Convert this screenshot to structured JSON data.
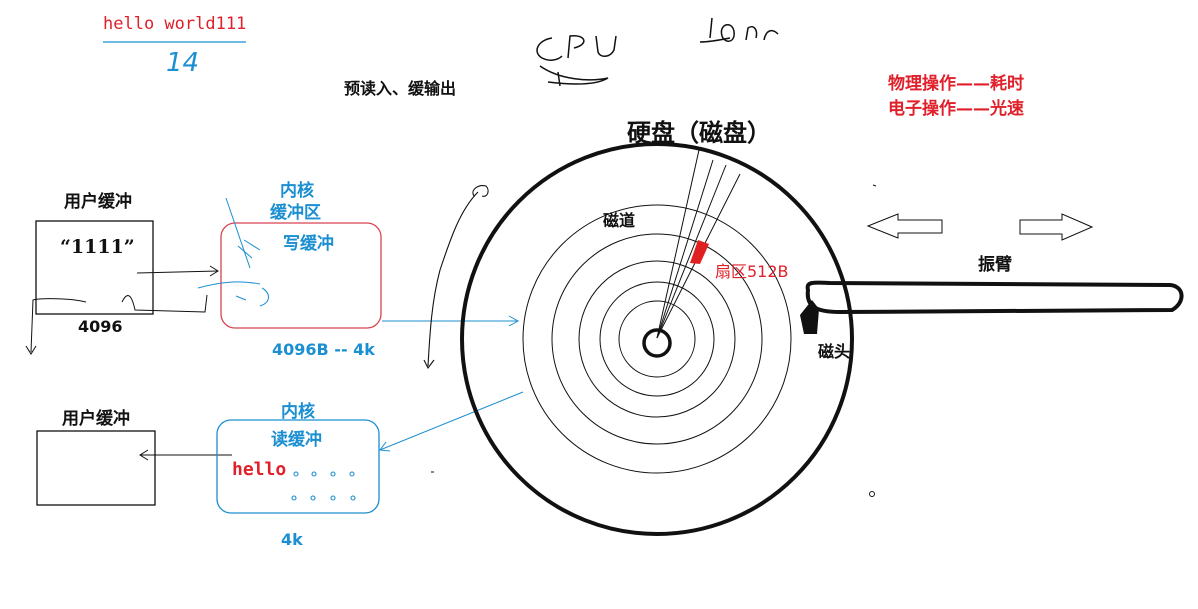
{
  "annotations": {
    "hello_world": "hello world111",
    "number_14": "14",
    "cpu_scribble": "CPU",
    "io_scribble": "IO",
    "readahead": "预读入、缓输出",
    "disk_title": "硬盘（磁盘）",
    "physical_op": "物理操作——耗时",
    "electronic_op": "电子操作——光速"
  },
  "write_side": {
    "user_buffer_label": "用户缓冲",
    "user_buffer_content": "“1111”",
    "user_buffer_size": "4096",
    "kernel_label": "内核",
    "kernel_buffer_label": "缓冲区",
    "write_buffer_label": "写缓冲",
    "write_buffer_size": "4096B -- 4k"
  },
  "read_side": {
    "user_buffer_label": "用户缓冲",
    "kernel_label": "内核",
    "read_buffer_label": "读缓冲",
    "read_buffer_content": "hello",
    "read_buffer_size": "4k"
  },
  "disk": {
    "track_label": "磁道",
    "sector_label": "扇区512B",
    "head_label": "磁头",
    "arm_label": "振臂"
  },
  "colors": {
    "red": "#e0202a",
    "blue": "#1b8fd1",
    "black": "#111111"
  }
}
